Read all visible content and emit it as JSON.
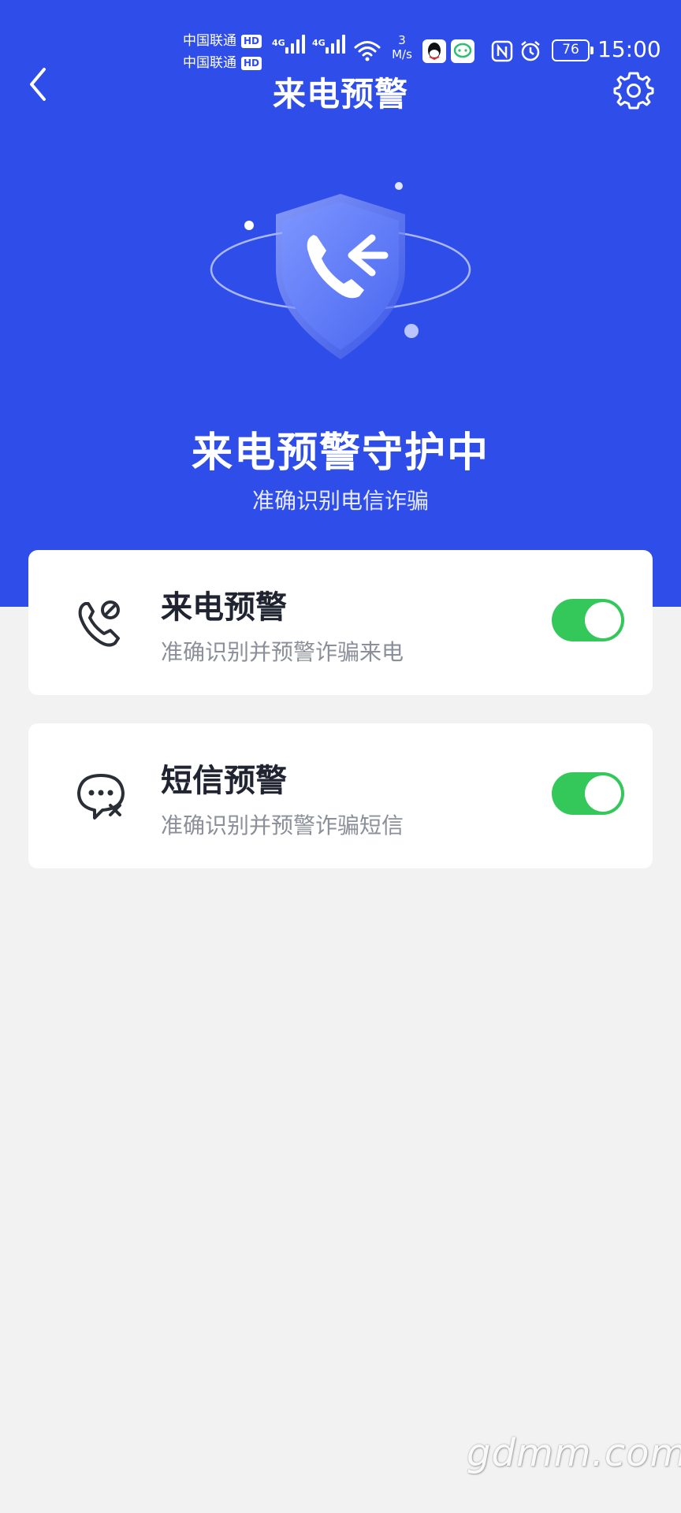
{
  "status_bar": {
    "carrier_1": "中国联通",
    "carrier_2": "中国联通",
    "hd_badge": "HD",
    "network_1": "4G",
    "network_2": "4G",
    "speed_value": "3",
    "speed_unit": "M/s",
    "battery_level": "76",
    "time": "15:00",
    "icons": [
      "signal-icon",
      "wifi-icon",
      "qq-icon",
      "messaging-app-icon",
      "nfc-icon",
      "alarm-icon",
      "battery-icon"
    ]
  },
  "header": {
    "title": "来电预警",
    "back_icon": "back-chevron-icon",
    "settings_icon": "gear-icon"
  },
  "hero": {
    "title": "来电预警守护中",
    "subtitle": "准确识别电信诈骗",
    "illustration_icon": "shield-incoming-call-icon"
  },
  "features": [
    {
      "title": "来电预警",
      "description": "准确识别并预警诈骗来电",
      "icon": "phone-alert-icon",
      "enabled": true
    },
    {
      "title": "短信预警",
      "description": "准确识别并预警诈骗短信",
      "icon": "message-alert-icon",
      "enabled": true
    }
  ],
  "watermark": "gdmm.com",
  "colors": {
    "primary_blue": "#2f4de8",
    "toggle_on": "#34c759",
    "background": "#f2f2f2",
    "card": "#ffffff"
  }
}
